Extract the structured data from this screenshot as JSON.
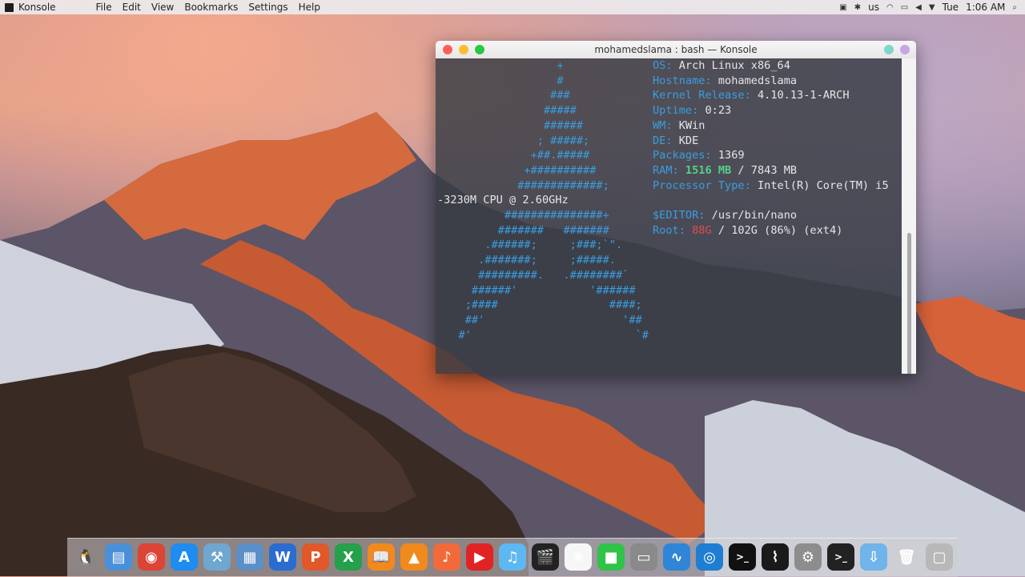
{
  "menubar": {
    "app_name": "Konsole",
    "menus": [
      "File",
      "Edit",
      "View",
      "Bookmarks",
      "Settings",
      "Help"
    ],
    "keyboard_layout": "us",
    "day": "Tue",
    "time": "1:06 AM"
  },
  "window": {
    "title": "mohamedslama : bash — Konsole"
  },
  "terminal": {
    "logo_lines": [
      "                  +",
      "                  #",
      "                 ###",
      "                #####",
      "                ######",
      "               ; #####;",
      "              +##.#####",
      "             +##########",
      "            #############;",
      "",
      "          ###############+",
      "         #######   #######",
      "       .######;     ;###;`\".",
      "      .#######;     ;#####.",
      "      #########.   .########`",
      "     ######'           '######",
      "    ;####                 ####;",
      "    ##'                     '##",
      "   #'                         `#"
    ],
    "wrap_line": "-3230M CPU @ 2.60GHz",
    "info": [
      {
        "key": "OS:",
        "value": " Arch Linux x86_64"
      },
      {
        "key": "Hostname:",
        "value": " mohamedslama"
      },
      {
        "key": "Kernel Release:",
        "value": " 4.10.13-1-ARCH"
      },
      {
        "key": "Uptime:",
        "value": " 0:23"
      },
      {
        "key": "WM:",
        "value": " KWin"
      },
      {
        "key": "DE:",
        "value": " KDE"
      },
      {
        "key": "Packages:",
        "value": " 1369"
      },
      {
        "key": "RAM:",
        "value_highlight": " 1516 MB",
        "value": " / 7843 MB"
      },
      {
        "key": "Processor Type:",
        "value": " Intel(R) Core(TM) i5"
      },
      {
        "key": "",
        "value": ""
      },
      {
        "key": "$EDITOR:",
        "value": " /usr/bin/nano"
      },
      {
        "key": "Root:",
        "value_alert": " 88G",
        "value": " / 102G (86%) (ext4)"
      }
    ]
  },
  "dock": {
    "icons": [
      {
        "name": "tux-icon",
        "glyph": "🐧",
        "bg": "transparent"
      },
      {
        "name": "keynote-icon",
        "glyph": "▤",
        "bg": "#4a90d9"
      },
      {
        "name": "chrome-icon",
        "glyph": "◉",
        "bg": "#db4437"
      },
      {
        "name": "app-store-icon",
        "glyph": "A",
        "bg": "#1e8cf0"
      },
      {
        "name": "xcode-icon",
        "glyph": "⚒",
        "bg": "#6fa7d0"
      },
      {
        "name": "preview-icon",
        "glyph": "▦",
        "bg": "#5b8fc7"
      },
      {
        "name": "word-icon",
        "glyph": "W",
        "bg": "#2b6cd1"
      },
      {
        "name": "wps-presentation-icon",
        "glyph": "P",
        "bg": "#e1582a"
      },
      {
        "name": "excel-icon",
        "glyph": "X",
        "bg": "#24a14a"
      },
      {
        "name": "ibooks-icon",
        "glyph": "📖",
        "bg": "#f08a1d"
      },
      {
        "name": "vlc-icon",
        "glyph": "▲",
        "bg": "#f08a1d"
      },
      {
        "name": "music-icon",
        "glyph": "♪",
        "bg": "#f26a3a"
      },
      {
        "name": "youtube-icon",
        "glyph": "▶",
        "bg": "#e02424"
      },
      {
        "name": "itunes-icon",
        "glyph": "♫",
        "bg": "#5db8f2"
      },
      {
        "name": "final-cut-icon",
        "glyph": "🎬",
        "bg": "#222"
      },
      {
        "name": "photos-icon",
        "glyph": "❀",
        "bg": "#f6f6f6"
      },
      {
        "name": "facetime-icon",
        "glyph": "■",
        "bg": "#2fc348"
      },
      {
        "name": "system-monitor-icon",
        "glyph": "▭",
        "bg": "#8a8a8a"
      },
      {
        "name": "wave-icon",
        "glyph": "∿",
        "bg": "#2f86d6"
      },
      {
        "name": "swirl-icon",
        "glyph": "◎",
        "bg": "#1f7ed2"
      },
      {
        "name": "terminal-icon",
        "glyph": ">_",
        "bg": "#111"
      },
      {
        "name": "activity-monitor-icon",
        "glyph": "⌇",
        "bg": "#1a1a1a"
      },
      {
        "name": "system-preferences-icon",
        "glyph": "⚙",
        "bg": "#8d8d8d"
      },
      {
        "name": "konsole-icon",
        "glyph": ">_",
        "bg": "#222"
      },
      {
        "name": "downloads-folder-icon",
        "glyph": "⇩",
        "bg": "#6fb4ea"
      },
      {
        "name": "trash-icon",
        "glyph": "🗑",
        "bg": "transparent"
      },
      {
        "name": "desktop-icon",
        "glyph": "▢",
        "bg": "#b8b8b8"
      }
    ]
  },
  "colors": {
    "term_key": "#3a9de0",
    "ram_highlight": "#55d08a",
    "disk_alert": "#e24c4c"
  }
}
